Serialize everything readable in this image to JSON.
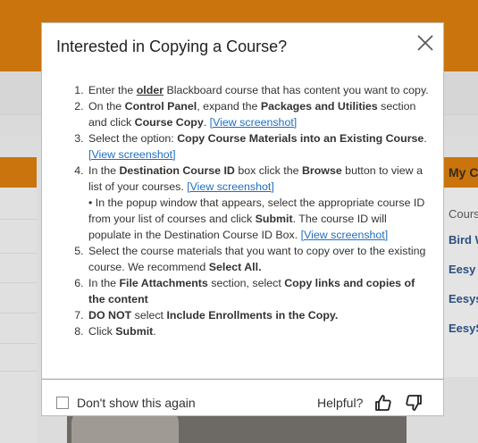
{
  "background": {
    "right_panel": {
      "heading": "My C",
      "label": "Cours",
      "links": [
        "Bird W",
        "Eesy A",
        "Eesys",
        "EesyS"
      ]
    }
  },
  "modal": {
    "title": "Interested in Copying a Course?",
    "link_text": "[View screenshot]",
    "steps": {
      "s1": {
        "a": "Enter the ",
        "b": "older",
        "c": " Blackboard course that has content you want to copy."
      },
      "s2": {
        "a": "On the ",
        "b": "Control Panel",
        "c": ", expand the ",
        "d": "Packages and Utilities",
        "e": " section and click ",
        "f": "Course Copy",
        "g": ". "
      },
      "s3": {
        "a": "Select the option: ",
        "b": "Copy Course Materials into an Existing Course",
        "c": ". "
      },
      "s4": {
        "a": "In the ",
        "b": "Destination Course ID",
        "c": " box click the ",
        "d": "Browse",
        "e": " button to view a list of your courses. ",
        "f": "• In the popup window that appears, select the appropriate course ID from your list of courses and click ",
        "g": "Submit",
        "h": ". The course ID will populate in the Destination Course ID Box. "
      },
      "s5": {
        "a": "Select the course materials that you want to copy over to the existing course. We recommend ",
        "b": "Select All."
      },
      "s6": {
        "a": "In the ",
        "b": "File Attachments",
        "c": " section, select ",
        "d": "Copy links and copies of the content"
      },
      "s7": {
        "a": "DO NOT",
        "b": " select ",
        "c": "Include Enrollments in the Copy."
      },
      "s8": {
        "a": "Click ",
        "b": "Submit",
        "c": "."
      }
    },
    "footer": {
      "checkbox_label": "Don't show this again",
      "checkbox_checked": false,
      "helpful_label": "Helpful?"
    }
  },
  "colors": {
    "accent": "#c9740d",
    "link": "#1f6fbf"
  }
}
